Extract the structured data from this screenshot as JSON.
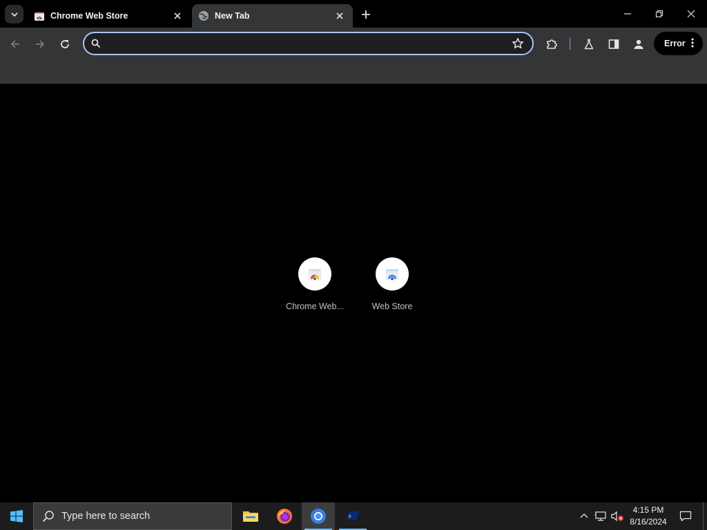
{
  "tabs": [
    {
      "title": "Chrome Web Store",
      "favicon": "chrome-web-store-icon",
      "active": false
    },
    {
      "title": "New Tab",
      "favicon": "globe-icon",
      "active": true
    }
  ],
  "window_controls": [
    "minimize-icon",
    "restore-icon",
    "close-icon"
  ],
  "omnibox": {
    "value": "",
    "placeholder": ""
  },
  "profile": {
    "error_label": "Error"
  },
  "shortcuts": [
    {
      "label": "Chrome Web...",
      "icon": "chrome-web-store-icon"
    },
    {
      "label": "Web Store",
      "icon": "web-store-icon"
    }
  ],
  "taskbar": {
    "search_placeholder": "Type here to search",
    "apps": [
      "file-explorer-icon",
      "firefox-icon",
      "chrome-icon",
      "terminal-icon"
    ],
    "time": "4:15 PM",
    "date": "8/16/2024"
  },
  "colors": {
    "toolbar": "#333537",
    "omnibox_border": "#a8c7fa",
    "background": "#000000",
    "taskbar": "#1c1c1c",
    "accent": "#76b9ed"
  }
}
